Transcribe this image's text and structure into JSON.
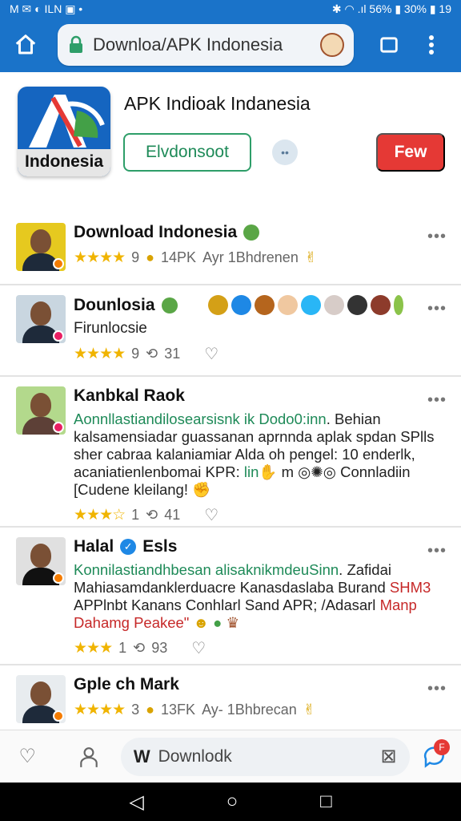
{
  "status": {
    "left_text": "M ✉ ◐ ILN ▣ •",
    "right_text": "✱ ◠ .ıl 56% ▮ 30% ▮ 19"
  },
  "browser": {
    "url": "Downloa/APK Indonesia",
    "home_icon": "home-icon",
    "tabs_icon": "tabs-icon",
    "menu_icon": "more-vert-icon"
  },
  "app": {
    "logo_label": "Indonesia",
    "title": "APK Indioak Indanesia",
    "install_label": "Elvdonsoot",
    "few_label": "Few",
    "loader_icon": "bubble-icon"
  },
  "posts": [
    {
      "name": "Download Indonesia",
      "rating": "9",
      "stat": "14PK",
      "extra": "Ayr 1Bhdrenen",
      "badge_color": "#f57c00"
    },
    {
      "name": "Dounlosia",
      "sub": "Firunlocsie",
      "rating": "9",
      "reposts": "31",
      "badge_color": "#e91e63"
    },
    {
      "name": "Kanbkal Raok",
      "text_green": "Aonnllastiandilosearsisnk ik Dodo0:inn",
      "text_1": ". Behian kalsamensiadar guassanan aprnnda aplak spdan SPlls sher cabraa kalaniamiar Alda oh pengel: 10 enderlk, acaniatienlenbomai KPR:",
      "text_green2": " lin",
      "text_2": " m",
      "text_3": " Connladiin [Cudene kleilang!",
      "rating": "1",
      "reposts": "41",
      "badge_color": "#e91e63"
    },
    {
      "name": "Halal",
      "name2": "Esls",
      "text_1": "Konnilastiandhbesan alisaknikmdeuSinn",
      "text_2": ". Zafidai Mahiasamdanklerduacre Kanasdaslaba Burand ",
      "text_red": "SHM3",
      "text_3": " APPlnbt Kanans Conhlarl Sand APR; /Adasarl ",
      "text_red2": "Manp Dahamg Peakee\"",
      "rating": "1",
      "reposts": "93",
      "badge_color": "#f57c00"
    },
    {
      "name": "Gple ch Mark",
      "rating": "3",
      "stat": "13FK",
      "extra": "Ay- 1Bhbrecan",
      "badge_color": "#f57c00"
    }
  ],
  "bottom_nav": {
    "search_prefix": "W",
    "search_text": "Downlodk",
    "chat_badge": "F"
  }
}
